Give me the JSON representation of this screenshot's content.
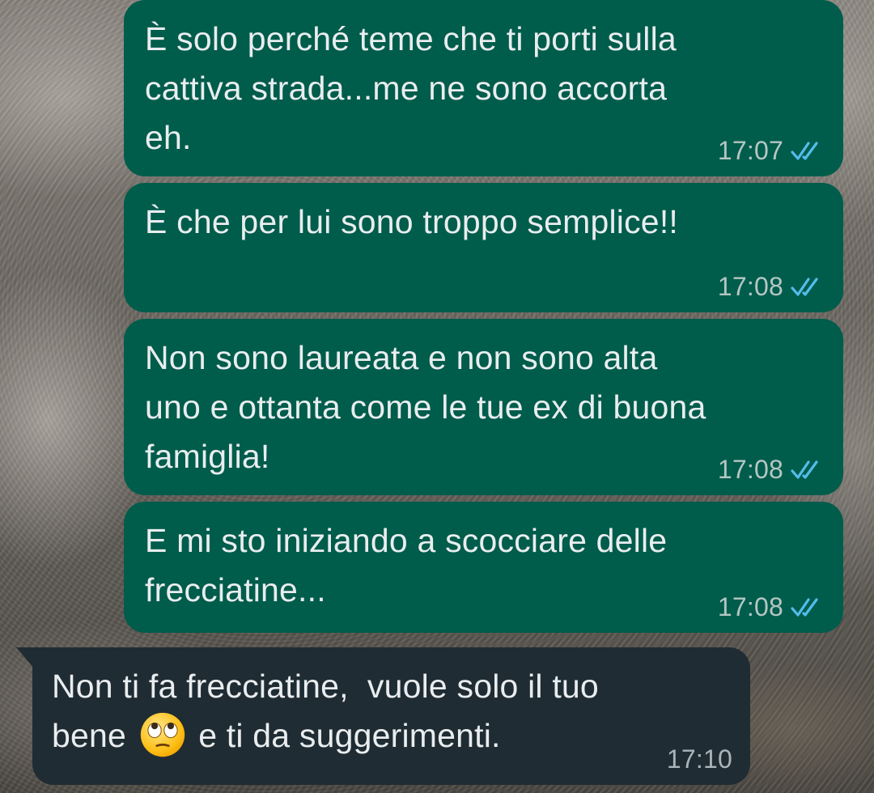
{
  "theme": {
    "outgoing_bubble_color": "#005c4b",
    "incoming_bubble_color": "#202c33",
    "text_color": "#e9edef",
    "read_tick_color": "#53bdeb"
  },
  "messages": [
    {
      "direction": "outgoing",
      "text": "È solo perché teme che ti porti sulla\ncattiva strada...me ne sono accorta\neh.",
      "time": "17:07",
      "status_icon": "double-check-read-icon"
    },
    {
      "direction": "outgoing",
      "text": "È che per lui sono troppo semplice!!",
      "time": "17:08",
      "status_icon": "double-check-read-icon"
    },
    {
      "direction": "outgoing",
      "text": "Non sono laureata e non sono alta\nuno e ottanta come le tue ex di buona\nfamiglia!",
      "time": "17:08",
      "status_icon": "double-check-read-icon"
    },
    {
      "direction": "outgoing",
      "text": "E mi sto iniziando a scocciare delle\nfrecciatine...",
      "time": "17:08",
      "status_icon": "double-check-read-icon"
    },
    {
      "direction": "incoming",
      "text_before_emoji": "Non ti fa frecciatine,  vuole solo il tuo\nbene ",
      "emoji": "face-with-rolling-eyes-emoji",
      "text_after_emoji": " e ti da suggerimenti.",
      "time": "17:10"
    }
  ]
}
